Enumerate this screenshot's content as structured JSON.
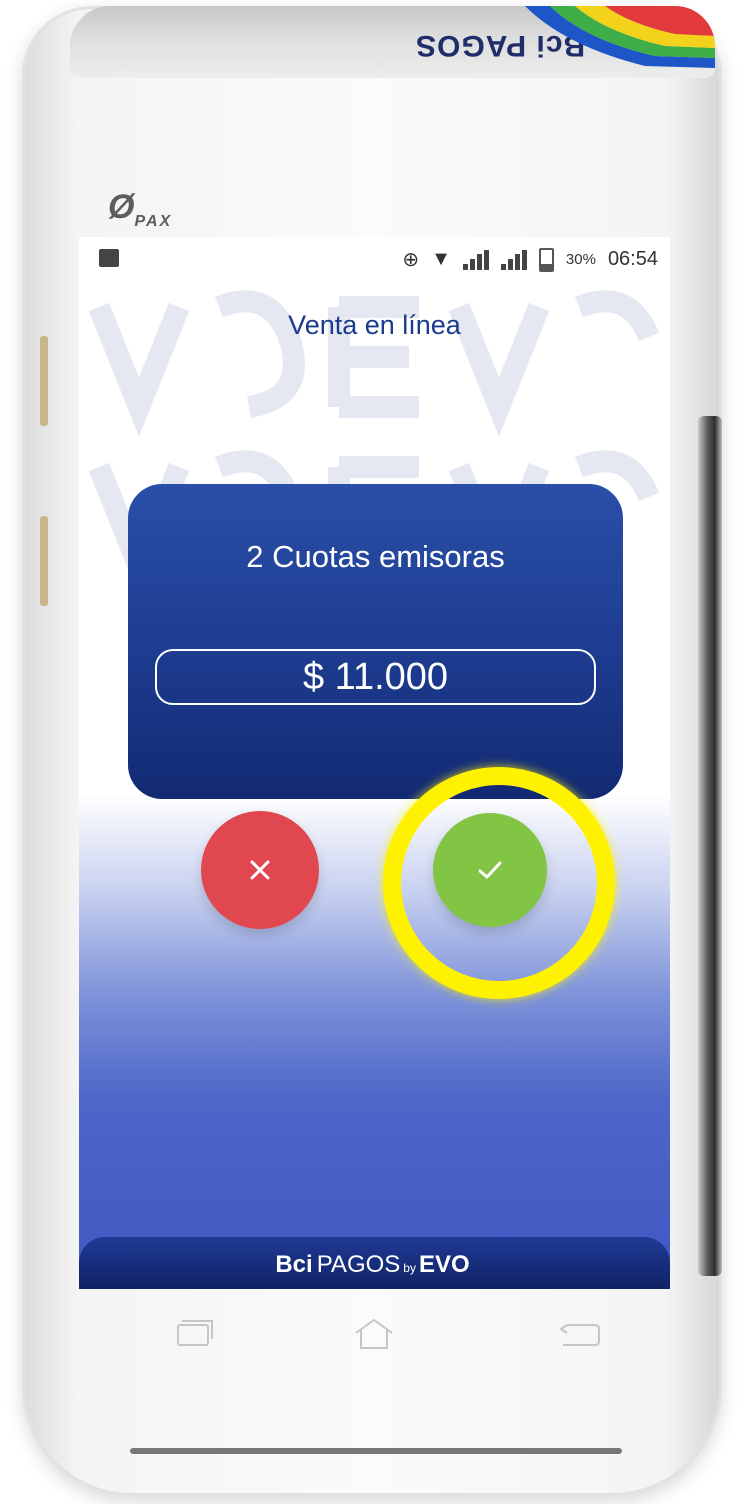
{
  "device": {
    "brand_logo": "PAX",
    "top_label": "Bci PAGOS"
  },
  "status_bar": {
    "battery": "30%",
    "time": "06:54"
  },
  "screen": {
    "title": "Venta en línea",
    "card": {
      "title": "2 Cuotas emisoras",
      "amount": "$ 11.000"
    },
    "buttons": {
      "cancel_icon": "close-icon",
      "accept_icon": "checkmark-icon"
    },
    "footer": {
      "brand_bold": "Bci",
      "brand_text": "PAGOS",
      "by": "by",
      "partner": "EVO"
    }
  },
  "colors": {
    "card": "#1d3b8f",
    "cancel": "#e1474f",
    "accept": "#82c443",
    "highlight": "#fff200",
    "title": "#1a3b8e"
  }
}
